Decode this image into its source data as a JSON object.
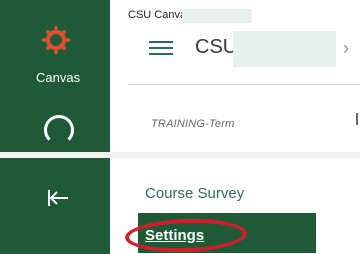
{
  "global_nav": {
    "logo_label": "Canvas",
    "icons": [
      "canvas-logo-icon",
      "account-icon",
      "collapse-left-icon"
    ],
    "colors": {
      "nav_bg": "#1e5a36",
      "logo": "#e04f2b"
    }
  },
  "header": {
    "breadcrumb_top": "CSU Canvas",
    "course_title_prefix": "CSU",
    "term": "TRAINING-Term"
  },
  "course_nav": {
    "items": [
      {
        "label": "Course Survey"
      },
      {
        "label": "Settings",
        "active": true
      }
    ]
  },
  "annotations": {
    "highlight_color": "#d01f2a"
  }
}
